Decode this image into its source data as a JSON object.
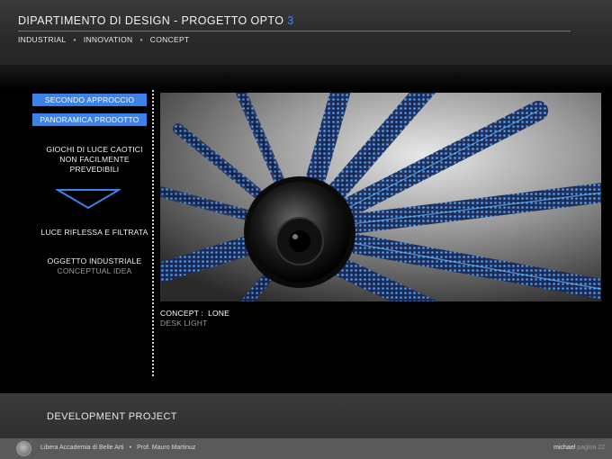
{
  "header": {
    "title_main": "DIPARTIMENTO DI DESIGN  -  PROGETTO OPTO ",
    "title_number": "3",
    "subnav": [
      "INDUSTRIAL",
      "INNOVATION",
      "CONCEPT"
    ],
    "separator": "•"
  },
  "menu": {
    "buttons": [
      "SECONDO APPROCCIO",
      "PANORAMICA PRODOTTO"
    ],
    "text_1": [
      "GIOCHI DI LUCE CAOTICI",
      "NON FACILMENTE",
      "PREVEDIBILI"
    ],
    "text_2": "LUCE RIFLESSA E FILTRATA",
    "text_3_main": "OGGETTO INDUSTRIALE",
    "text_3_sub": "CONCEPTUAL IDEA"
  },
  "caption": {
    "label": "CONCEPT :",
    "name": "LONE",
    "sub": "DESK LIGHT"
  },
  "band": {
    "title": "DEVELOPMENT PROJECT"
  },
  "footer": {
    "school": "Libera Accademia di Belle Arti",
    "separator": "•",
    "professor": "Prof. Mauro Martinuz",
    "author": "michael",
    "page": "pagina 22"
  },
  "colors": {
    "accent": "#3d82e8",
    "header_bg": "#333333",
    "footer_bg": "#5a5a5a"
  }
}
